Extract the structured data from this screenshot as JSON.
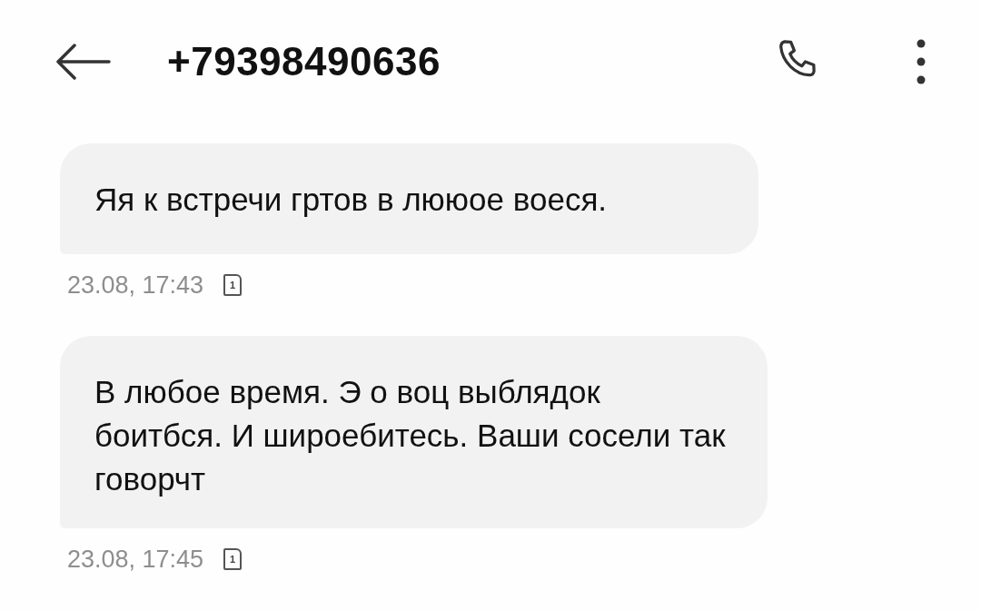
{
  "header": {
    "title": "+79398490636"
  },
  "messages": [
    {
      "text": "Яя к встречи гртов в лююое воеся.",
      "time": "23.08, 17:43",
      "sim": "1"
    },
    {
      "text": "В любое время. Э о воц выблядок боитбся. И широебитесь. Ваши сосели так говорчт",
      "time": "23.08, 17:45",
      "sim": "1"
    }
  ]
}
